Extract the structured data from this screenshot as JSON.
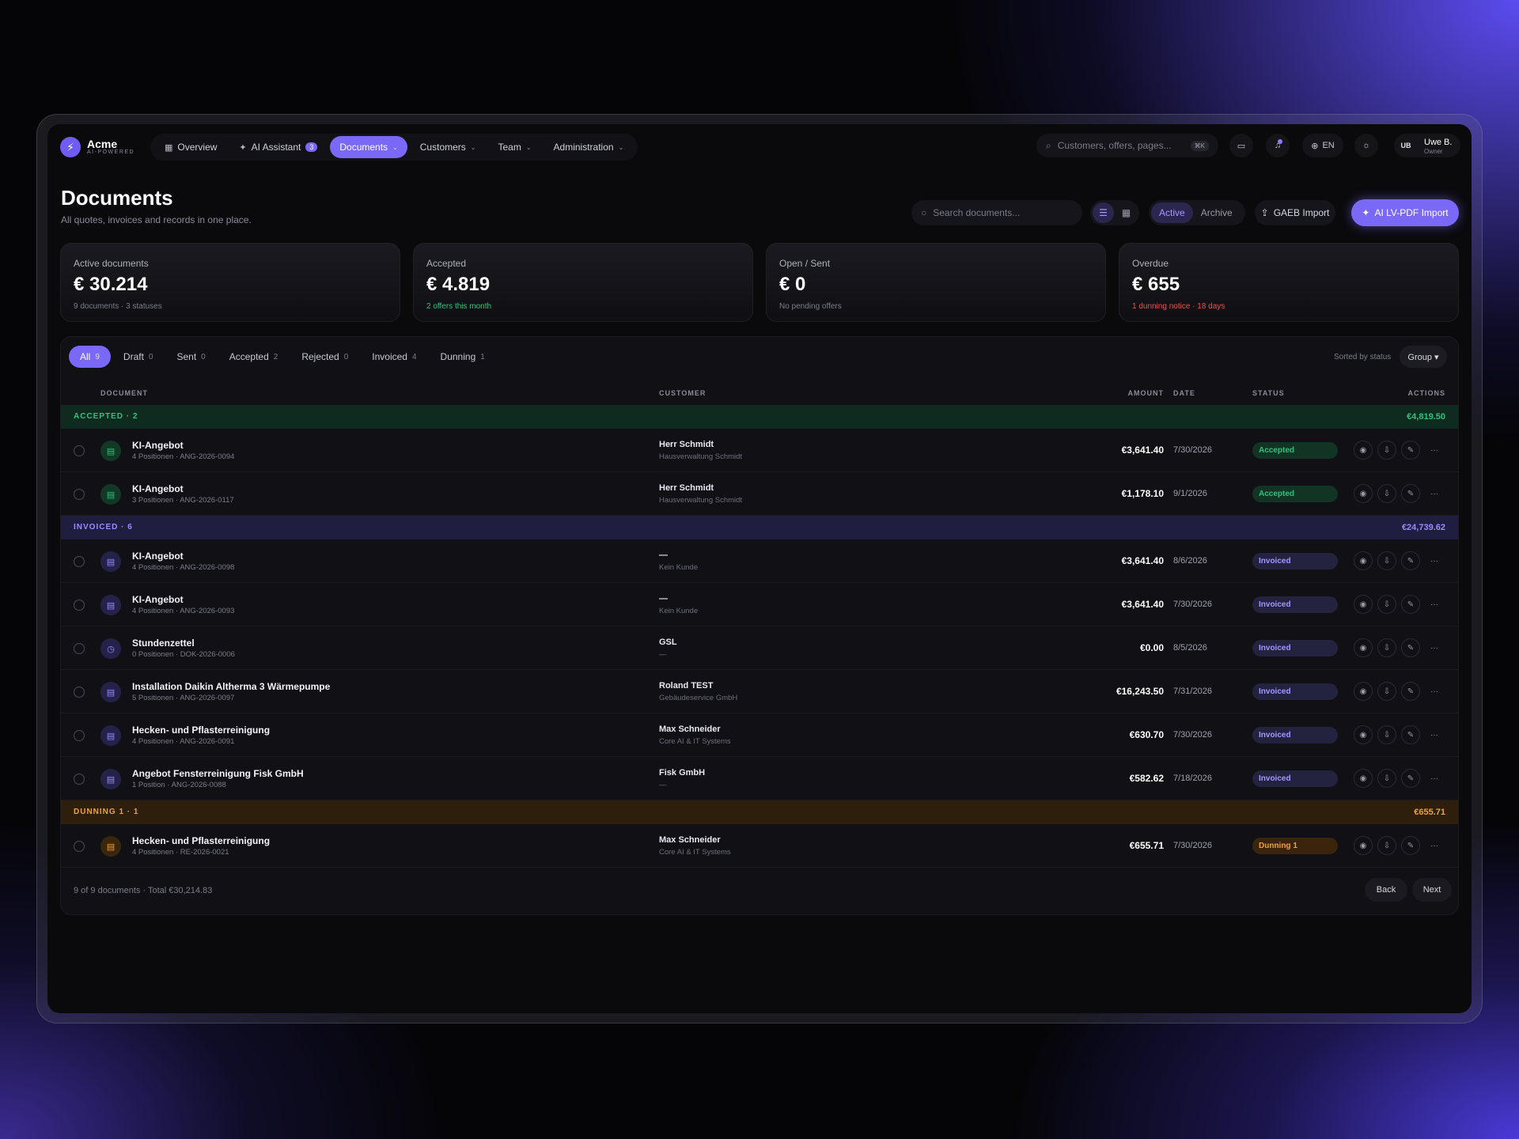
{
  "app": {
    "logo_mark": "⚡",
    "name": "Acme",
    "tagline": "AI-POWERED"
  },
  "nav": {
    "overview": "Overview",
    "ai_assistant": "AI Assistant",
    "ai_badge": "3",
    "documents": "Documents",
    "customers": "Customers",
    "team": "Team",
    "administration": "Administration"
  },
  "topbar": {
    "search_placeholder": "Customers, offers, pages...",
    "search_kbd": "⌘K",
    "language": "EN",
    "user_initials": "UB",
    "user_name": "Uwe B.",
    "user_role": "Owner"
  },
  "header": {
    "title": "Documents",
    "subtitle": "All quotes, invoices and records in one place.",
    "search_placeholder": "Search documents...",
    "seg_active": "Active",
    "seg_archive": "Archive",
    "gaeb_import": "GAEB Import",
    "ai_import": "AI LV-PDF Import"
  },
  "kpis": [
    {
      "label": "Active documents",
      "value": "€ 30.214",
      "note": "9 documents · 3 statuses"
    },
    {
      "label": "Accepted",
      "value": "€ 4.819",
      "note": "2 offers this month"
    },
    {
      "label": "Open / Sent",
      "value": "€ 0",
      "note": "No pending offers"
    },
    {
      "label": "Overdue",
      "value": "€ 655",
      "note": "1 dunning notice · 18 days"
    }
  ],
  "filters": [
    {
      "label": "All",
      "count": "9"
    },
    {
      "label": "Draft",
      "count": "0"
    },
    {
      "label": "Sent",
      "count": "0"
    },
    {
      "label": "Accepted",
      "count": "2"
    },
    {
      "label": "Rejected",
      "count": "0"
    },
    {
      "label": "Invoiced",
      "count": "4"
    },
    {
      "label": "Dunning",
      "count": "1"
    }
  ],
  "sort": {
    "label": "Sorted by status",
    "group": "Group ▾"
  },
  "columns": {
    "document": "DOCUMENT",
    "customer": "CUSTOMER",
    "amount": "AMOUNT",
    "date": "DATE",
    "status": "STATUS",
    "actions": "ACTIONS"
  },
  "groups": {
    "accepted": {
      "label": "ACCEPTED · 2",
      "total": "€4,819.50"
    },
    "invoiced": {
      "label": "INVOICED · 6",
      "total": "€24,739.62"
    },
    "dunning": {
      "label": "DUNNING 1 · 1",
      "total": "€655.71"
    }
  },
  "rows": [
    {
      "title": "KI-Angebot",
      "sub": "4 Positionen · ANG-2026-0094",
      "customer": "Herr Schmidt",
      "customer_sub": "Hausverwaltung Schmidt",
      "amount": "€3,641.40",
      "date": "7/30/2026",
      "status": "Accepted",
      "icon": "document-icon"
    },
    {
      "title": "KI-Angebot",
      "sub": "3 Positionen · ANG-2026-0117",
      "customer": "Herr Schmidt",
      "customer_sub": "Hausverwaltung Schmidt",
      "amount": "€1,178.10",
      "date": "9/1/2026",
      "status": "Accepted",
      "icon": "document-icon"
    },
    {
      "title": "KI-Angebot",
      "sub": "4 Positionen · ANG-2026-0098",
      "customer": "—",
      "customer_sub": "Kein Kunde",
      "amount": "€3,641.40",
      "date": "8/6/2026",
      "status": "Invoiced",
      "icon": "document-icon"
    },
    {
      "title": "KI-Angebot",
      "sub": "4 Positionen · ANG-2026-0093",
      "customer": "—",
      "customer_sub": "Kein Kunde",
      "amount": "€3,641.40",
      "date": "7/30/2026",
      "status": "Invoiced",
      "icon": "document-icon"
    },
    {
      "title": "Stundenzettel",
      "sub": "0 Positionen · DOK-2026-0006",
      "customer": "GSL",
      "customer_sub": "—",
      "amount": "€0.00",
      "date": "8/5/2026",
      "status": "Invoiced",
      "icon": "clock-icon"
    },
    {
      "title": "Installation Daikin Altherma 3 Wärmepumpe",
      "sub": "5 Positionen · ANG-2026-0097",
      "customer": "Roland TEST",
      "customer_sub": "Gebäudeservice GmbH",
      "amount": "€16,243.50",
      "date": "7/31/2026",
      "status": "Invoiced",
      "icon": "document-icon"
    },
    {
      "title": "Hecken- und Pflasterreinigung",
      "sub": "4 Positionen · ANG-2026-0091",
      "customer": "Max Schneider",
      "customer_sub": "Core AI & IT Systems",
      "amount": "€630.70",
      "date": "7/30/2026",
      "status": "Invoiced",
      "icon": "document-icon"
    },
    {
      "title": "Angebot Fensterreinigung Fisk GmbH",
      "sub": "1 Position · ANG-2026-0088",
      "customer": "Fisk GmbH",
      "customer_sub": "—",
      "amount": "€582.62",
      "date": "7/18/2026",
      "status": "Invoiced",
      "icon": "document-icon"
    },
    {
      "title": "Hecken- und Pflasterreinigung",
      "sub": "4 Positionen · RE-2026-0021",
      "customer": "Max Schneider",
      "customer_sub": "Core AI & IT Systems",
      "amount": "€655.71",
      "date": "7/30/2026",
      "status": "Dunning 1",
      "icon": "document-icon"
    }
  ],
  "footer": {
    "summary": "9 of 9 documents · Total €30,214.83",
    "back": "Back",
    "next": "Next"
  },
  "colors": {
    "accent": "#7a68f6",
    "accepted": "#2ec27e",
    "invoiced": "#9a8cff",
    "dunning": "#f0a03a",
    "overdue": "#f0504a"
  }
}
